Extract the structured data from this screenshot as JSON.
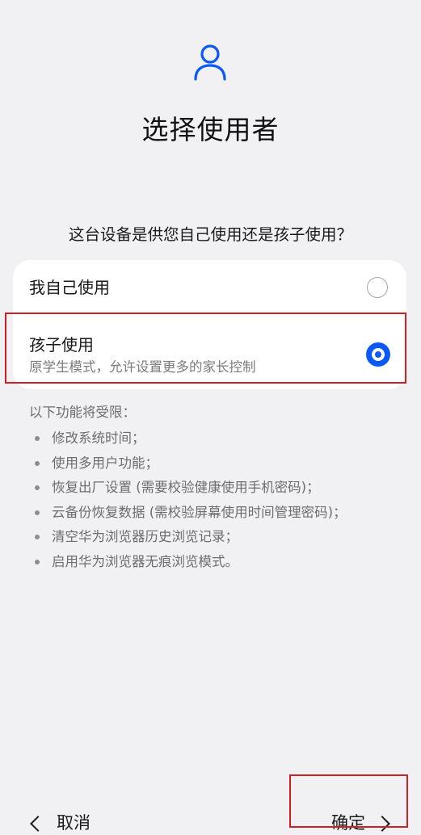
{
  "header": {
    "icon": "user-icon",
    "title": "选择使用者"
  },
  "question": "这台设备是供您自己使用还是孩子使用？",
  "options": [
    {
      "label": "我自己使用",
      "selected": false
    },
    {
      "label": "孩子使用",
      "description": "原学生模式，允许设置更多的家长控制",
      "selected": true
    }
  ],
  "restrictions": {
    "title": "以下功能将受限：",
    "items": [
      "修改系统时间；",
      "使用多用户功能；",
      "恢复出厂设置 (需要校验健康使用手机密码)；",
      "云备份恢复数据 (需校验屏幕使用时间管理密码)；",
      "清空华为浏览器历史浏览记录；",
      "启用华为浏览器无痕浏览模式。"
    ]
  },
  "footer": {
    "cancel_label": "取消",
    "confirm_label": "确定"
  },
  "colors": {
    "accent": "#0a59f7",
    "highlight": "#cc1f26",
    "background": "#f1f1f3"
  }
}
